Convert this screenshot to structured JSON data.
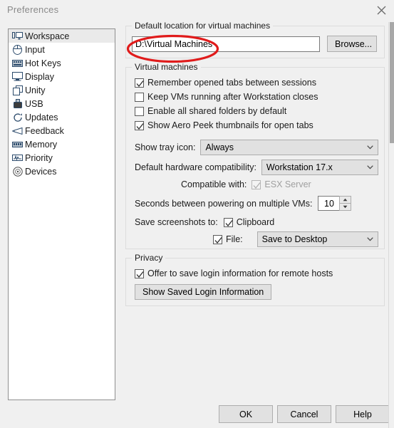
{
  "window": {
    "title": "Preferences",
    "close_icon": "close-x-icon"
  },
  "sidebar": {
    "items": [
      {
        "label": "Workspace",
        "icon": "workspace-monitor-icon",
        "selected": true
      },
      {
        "label": "Input",
        "icon": "mouse-icon",
        "selected": false
      },
      {
        "label": "Hot Keys",
        "icon": "keyboard-icon",
        "selected": false
      },
      {
        "label": "Display",
        "icon": "monitor-icon",
        "selected": false
      },
      {
        "label": "Unity",
        "icon": "windows-stack-icon",
        "selected": false
      },
      {
        "label": "USB",
        "icon": "usb-drive-icon",
        "selected": false
      },
      {
        "label": "Updates",
        "icon": "refresh-circular-icon",
        "selected": false
      },
      {
        "label": "Feedback",
        "icon": "megaphone-icon",
        "selected": false
      },
      {
        "label": "Memory",
        "icon": "memory-chip-icon",
        "selected": false
      },
      {
        "label": "Priority",
        "icon": "waveform-icon",
        "selected": false
      },
      {
        "label": "Devices",
        "icon": "disc-icon",
        "selected": false
      }
    ]
  },
  "default_location": {
    "group_title": "Default location for virtual machines",
    "path_value": "D:\\Virtual Machines",
    "browse_label": "Browse..."
  },
  "virtual_machines": {
    "group_title": "Virtual machines",
    "checkboxes": [
      {
        "label": "Remember opened tabs between sessions",
        "checked": true,
        "disabled": false
      },
      {
        "label": "Keep VMs running after Workstation closes",
        "checked": false,
        "disabled": false
      },
      {
        "label": "Enable all shared folders by default",
        "checked": false,
        "disabled": false
      },
      {
        "label": "Show Aero Peek thumbnails for open tabs",
        "checked": true,
        "disabled": false
      }
    ],
    "tray_icon_label": "Show tray icon:",
    "tray_icon_value": "Always",
    "hardware_compat_label": "Default hardware compatibility:",
    "hardware_compat_value": "Workstation 17.x",
    "compatible_with_label": "Compatible with:",
    "compatible_with_option": "ESX Server",
    "compatible_with_checked": true,
    "compatible_with_disabled": true,
    "seconds_label": "Seconds between powering on multiple VMs:",
    "seconds_value": "10",
    "save_screenshots_label": "Save screenshots to:",
    "clipboard_label": "Clipboard",
    "clipboard_checked": true,
    "file_label": "File:",
    "file_checked": true,
    "file_target_value": "Save to Desktop"
  },
  "privacy": {
    "group_title": "Privacy",
    "offer_login_label": "Offer to save login information for remote hosts",
    "offer_login_checked": true,
    "show_saved_login_label": "Show Saved Login Information"
  },
  "footer": {
    "ok_label": "OK",
    "cancel_label": "Cancel",
    "help_label": "Help"
  },
  "annotation": {
    "shape": "red-oval-highlight",
    "color": "#e01b1b",
    "targets": "path_value"
  }
}
